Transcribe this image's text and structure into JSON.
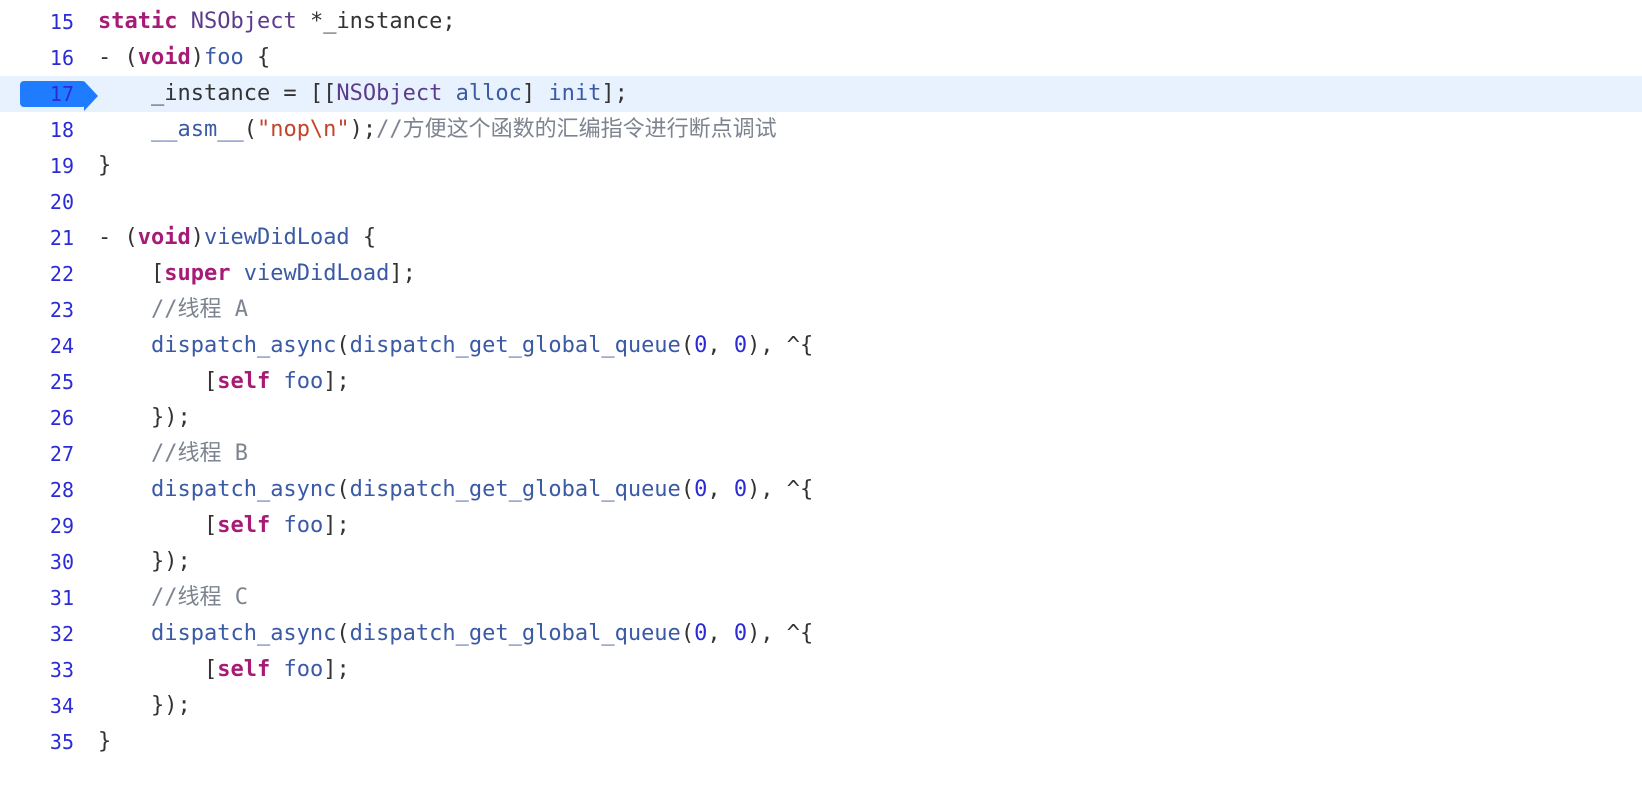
{
  "lines": [
    {
      "n": 15,
      "hl": false,
      "tokens": [
        {
          "c": "kw",
          "t": "static"
        },
        {
          "c": "plain",
          "t": " "
        },
        {
          "c": "type",
          "t": "NSObject"
        },
        {
          "c": "plain",
          "t": " *_instance;"
        }
      ]
    },
    {
      "n": 16,
      "hl": false,
      "tokens": [
        {
          "c": "plain",
          "t": "- ("
        },
        {
          "c": "kw",
          "t": "void"
        },
        {
          "c": "plain",
          "t": ")"
        },
        {
          "c": "func",
          "t": "foo"
        },
        {
          "c": "plain",
          "t": " {"
        }
      ]
    },
    {
      "n": 17,
      "hl": true,
      "tokens": [
        {
          "c": "plain",
          "t": "    _instance = [["
        },
        {
          "c": "type",
          "t": "NSObject"
        },
        {
          "c": "plain",
          "t": " "
        },
        {
          "c": "func",
          "t": "alloc"
        },
        {
          "c": "plain",
          "t": "] "
        },
        {
          "c": "func",
          "t": "init"
        },
        {
          "c": "plain",
          "t": "];"
        }
      ]
    },
    {
      "n": 18,
      "hl": false,
      "tokens": [
        {
          "c": "plain",
          "t": "    "
        },
        {
          "c": "func",
          "t": "__asm__"
        },
        {
          "c": "plain",
          "t": "("
        },
        {
          "c": "str",
          "t": "\"nop\\n\""
        },
        {
          "c": "plain",
          "t": ");"
        },
        {
          "c": "cmt",
          "t": "//方便这个函数的汇编指令进行断点调试"
        }
      ]
    },
    {
      "n": 19,
      "hl": false,
      "tokens": [
        {
          "c": "plain",
          "t": "}"
        }
      ]
    },
    {
      "n": 20,
      "hl": false,
      "tokens": [
        {
          "c": "plain",
          "t": ""
        }
      ]
    },
    {
      "n": 21,
      "hl": false,
      "tokens": [
        {
          "c": "plain",
          "t": "- ("
        },
        {
          "c": "kw",
          "t": "void"
        },
        {
          "c": "plain",
          "t": ")"
        },
        {
          "c": "func",
          "t": "viewDidLoad"
        },
        {
          "c": "plain",
          "t": " {"
        }
      ]
    },
    {
      "n": 22,
      "hl": false,
      "tokens": [
        {
          "c": "plain",
          "t": "    ["
        },
        {
          "c": "kw",
          "t": "super"
        },
        {
          "c": "plain",
          "t": " "
        },
        {
          "c": "func",
          "t": "viewDidLoad"
        },
        {
          "c": "plain",
          "t": "];"
        }
      ]
    },
    {
      "n": 23,
      "hl": false,
      "tokens": [
        {
          "c": "plain",
          "t": "    "
        },
        {
          "c": "cmt",
          "t": "//线程 A"
        }
      ]
    },
    {
      "n": 24,
      "hl": false,
      "tokens": [
        {
          "c": "plain",
          "t": "    "
        },
        {
          "c": "func",
          "t": "dispatch_async"
        },
        {
          "c": "plain",
          "t": "("
        },
        {
          "c": "func",
          "t": "dispatch_get_global_queue"
        },
        {
          "c": "plain",
          "t": "("
        },
        {
          "c": "num",
          "t": "0"
        },
        {
          "c": "plain",
          "t": ", "
        },
        {
          "c": "num",
          "t": "0"
        },
        {
          "c": "plain",
          "t": "), ^{"
        }
      ]
    },
    {
      "n": 25,
      "hl": false,
      "tokens": [
        {
          "c": "plain",
          "t": "        ["
        },
        {
          "c": "kw",
          "t": "self"
        },
        {
          "c": "plain",
          "t": " "
        },
        {
          "c": "func",
          "t": "foo"
        },
        {
          "c": "plain",
          "t": "];"
        }
      ]
    },
    {
      "n": 26,
      "hl": false,
      "tokens": [
        {
          "c": "plain",
          "t": "    });"
        }
      ]
    },
    {
      "n": 27,
      "hl": false,
      "tokens": [
        {
          "c": "plain",
          "t": "    "
        },
        {
          "c": "cmt",
          "t": "//线程 B"
        }
      ]
    },
    {
      "n": 28,
      "hl": false,
      "tokens": [
        {
          "c": "plain",
          "t": "    "
        },
        {
          "c": "func",
          "t": "dispatch_async"
        },
        {
          "c": "plain",
          "t": "("
        },
        {
          "c": "func",
          "t": "dispatch_get_global_queue"
        },
        {
          "c": "plain",
          "t": "("
        },
        {
          "c": "num",
          "t": "0"
        },
        {
          "c": "plain",
          "t": ", "
        },
        {
          "c": "num",
          "t": "0"
        },
        {
          "c": "plain",
          "t": "), ^{"
        }
      ]
    },
    {
      "n": 29,
      "hl": false,
      "tokens": [
        {
          "c": "plain",
          "t": "        ["
        },
        {
          "c": "kw",
          "t": "self"
        },
        {
          "c": "plain",
          "t": " "
        },
        {
          "c": "func",
          "t": "foo"
        },
        {
          "c": "plain",
          "t": "];"
        }
      ]
    },
    {
      "n": 30,
      "hl": false,
      "tokens": [
        {
          "c": "plain",
          "t": "    });"
        }
      ]
    },
    {
      "n": 31,
      "hl": false,
      "tokens": [
        {
          "c": "plain",
          "t": "    "
        },
        {
          "c": "cmt",
          "t": "//线程 C"
        }
      ]
    },
    {
      "n": 32,
      "hl": false,
      "tokens": [
        {
          "c": "plain",
          "t": "    "
        },
        {
          "c": "func",
          "t": "dispatch_async"
        },
        {
          "c": "plain",
          "t": "("
        },
        {
          "c": "func",
          "t": "dispatch_get_global_queue"
        },
        {
          "c": "plain",
          "t": "("
        },
        {
          "c": "num",
          "t": "0"
        },
        {
          "c": "plain",
          "t": ", "
        },
        {
          "c": "num",
          "t": "0"
        },
        {
          "c": "plain",
          "t": "), ^{"
        }
      ]
    },
    {
      "n": 33,
      "hl": false,
      "tokens": [
        {
          "c": "plain",
          "t": "        ["
        },
        {
          "c": "kw",
          "t": "self"
        },
        {
          "c": "plain",
          "t": " "
        },
        {
          "c": "func",
          "t": "foo"
        },
        {
          "c": "plain",
          "t": "];"
        }
      ]
    },
    {
      "n": 34,
      "hl": false,
      "tokens": [
        {
          "c": "plain",
          "t": "    });"
        }
      ]
    },
    {
      "n": 35,
      "hl": false,
      "tokens": [
        {
          "c": "plain",
          "t": "}"
        }
      ]
    }
  ]
}
